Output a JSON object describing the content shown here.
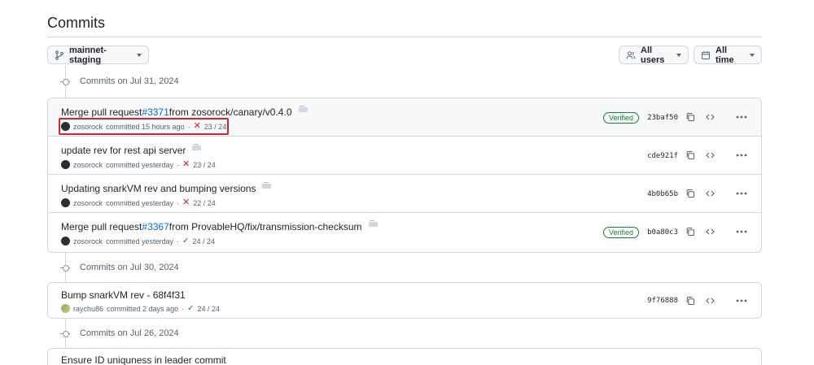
{
  "page": {
    "title": "Commits"
  },
  "filters": {
    "branch": "mainnet-staging",
    "users": "All users",
    "time": "All time"
  },
  "groups": [
    {
      "date_label": "Commits on Jul 31, 2024",
      "commits": [
        {
          "title_prefix": "Merge pull request ",
          "pr": "#3371",
          "title_suffix": " from zosorock/canary/v0.4.0",
          "author": "zosorock",
          "when": "committed 15 hours ago",
          "status": "fail",
          "checks": "23 / 24",
          "verified": "Verified",
          "sha": "23baf50"
        },
        {
          "title_prefix": "update rev for rest api server",
          "pr": "",
          "title_suffix": "",
          "author": "zosorock",
          "when": "committed yesterday",
          "status": "fail",
          "checks": "23 / 24",
          "verified": "",
          "sha": "cde921f"
        },
        {
          "title_prefix": "Updating snarkVM rev and bumping versions",
          "pr": "",
          "title_suffix": "",
          "author": "zosorock",
          "when": "committed yesterday",
          "status": "fail",
          "checks": "22 / 24",
          "verified": "",
          "sha": "4b0b65b"
        },
        {
          "title_prefix": "Merge pull request ",
          "pr": "#3367",
          "title_suffix": " from ProvableHQ/fix/transmission-checksum",
          "author": "zosorock",
          "when": "committed yesterday",
          "status": "pass",
          "checks": "24 / 24",
          "verified": "Verified",
          "sha": "b0a80c3"
        }
      ]
    },
    {
      "date_label": "Commits on Jul 30, 2024",
      "commits": [
        {
          "title_prefix": "Bump snarkVM rev - 68f4f31",
          "pr": "",
          "title_suffix": "",
          "author": "raychu86",
          "when": "committed 2 days ago",
          "status": "pass",
          "checks": "24 / 24",
          "verified": "",
          "sha": "9f76888"
        }
      ]
    },
    {
      "date_label": "Commits on Jul 26, 2024",
      "commits": [
        {
          "title_prefix": "Ensure ID uniquness in leader commit",
          "pr": "",
          "title_suffix": "",
          "author": "",
          "when": "",
          "status": "",
          "checks": "",
          "verified": "",
          "sha": ""
        }
      ]
    }
  ],
  "icons": {
    "branch": "git-branch-icon",
    "users": "people-icon",
    "time": "calendar-icon",
    "copy": "copy-icon",
    "code": "code-icon",
    "more": "kebab-horizontal-icon"
  },
  "colors": {
    "link": "#0969da",
    "fail": "#cf222e",
    "pass": "#1a7f37",
    "highlight_box": "#d1242f"
  }
}
